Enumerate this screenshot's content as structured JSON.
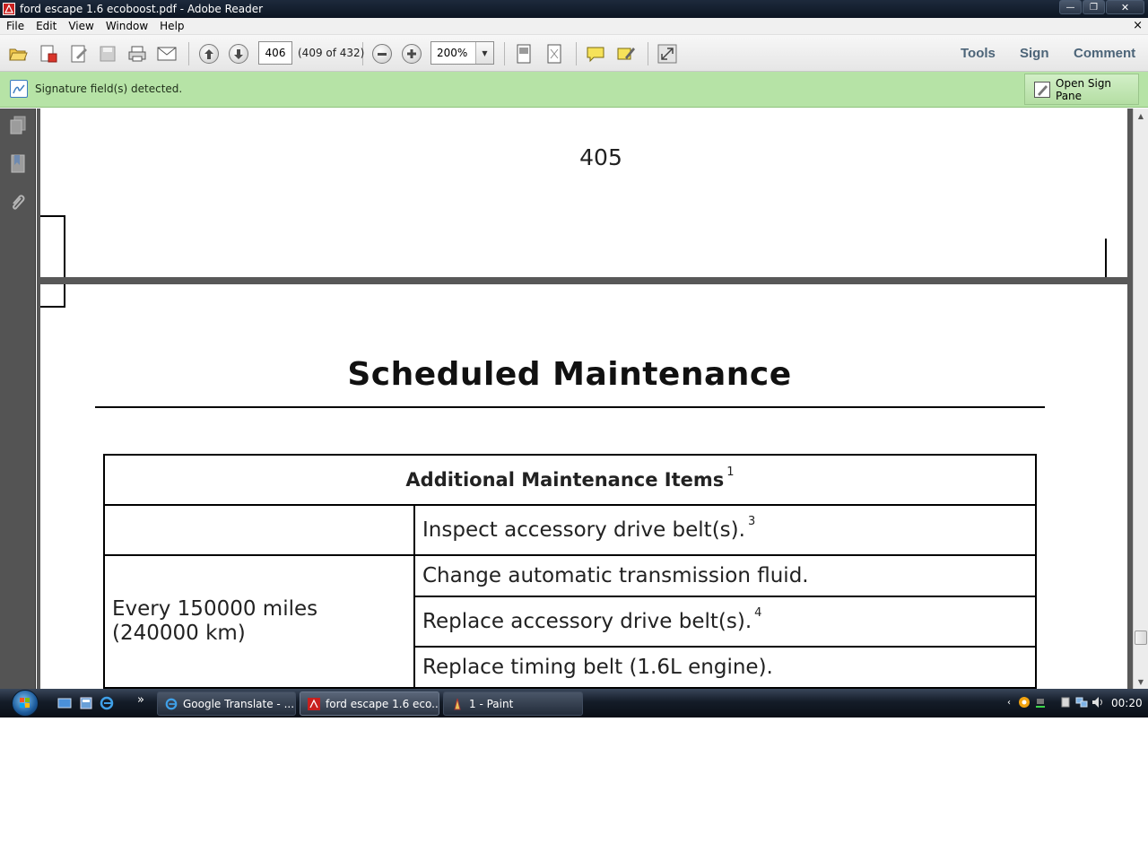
{
  "window": {
    "title": "ford escape 1.6 ecoboost.pdf - Adobe Reader",
    "minimize": "—",
    "maximize": "❐",
    "close": "✕"
  },
  "menubar": {
    "items": [
      "File",
      "Edit",
      "View",
      "Window",
      "Help"
    ],
    "doc_close": "×"
  },
  "toolbar": {
    "page_value": "406",
    "page_count": "(409 of 432)",
    "zoom_value": "200%",
    "links": [
      "Tools",
      "Sign",
      "Comment"
    ]
  },
  "notification": {
    "message": "Signature field(s) detected.",
    "button_label": "Open Sign Pane"
  },
  "document": {
    "prev_page_number": "405",
    "heading": "Scheduled Maintenance",
    "table": {
      "header": "Additional Maintenance Items",
      "header_note": "1",
      "rows": [
        {
          "interval": "",
          "item": "Inspect accessory drive belt(s).",
          "note": "3"
        },
        {
          "interval": "Every 150000 miles (240000 km)",
          "item": "Change automatic transmission fluid.",
          "note": ""
        },
        {
          "interval": "",
          "item": "Replace accessory drive belt(s).",
          "note": "4"
        },
        {
          "interval": "",
          "item": "Replace timing belt (1.6L engine).",
          "note": ""
        }
      ]
    }
  },
  "taskbar": {
    "more_glyph": "»",
    "buttons": [
      {
        "label": "Google Translate - ...",
        "icon": "internet-explorer-icon"
      },
      {
        "label": "ford escape 1.6 eco...",
        "icon": "adobe-reader-icon"
      },
      {
        "label": "1 - Paint",
        "icon": "paint-icon"
      }
    ],
    "tray_arrow": "‹",
    "clock": "00:20"
  },
  "colors": {
    "notify_bg": "#b6e3a6",
    "viewer_bg": "#585858",
    "link_color": "#4c6478"
  }
}
